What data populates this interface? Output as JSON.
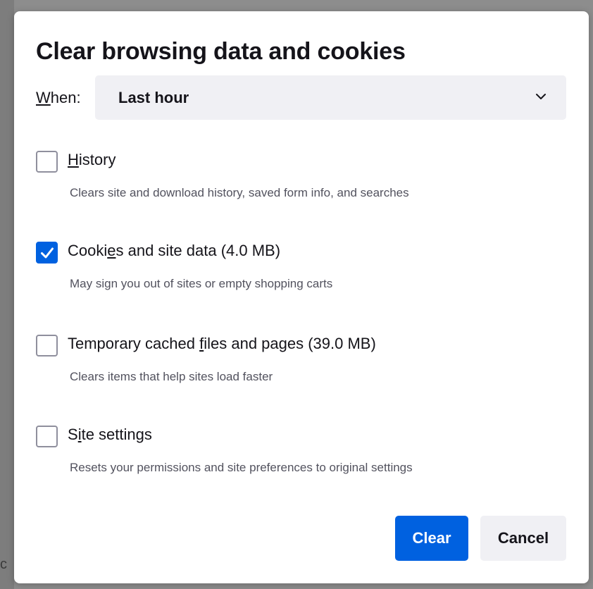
{
  "dialog": {
    "title": "Clear browsing data and cookies",
    "when": {
      "label_prefix": "",
      "label_access": "W",
      "label_rest": "hen:",
      "selected": "Last hour"
    },
    "options": [
      {
        "label_before": "",
        "label_access": "H",
        "label_after": "istory",
        "description": "Clears site and download history, saved form info, and searches",
        "checked": false
      },
      {
        "label_before": "Cooki",
        "label_access": "e",
        "label_after": "s and site data (4.0 MB)",
        "description": "May sign you out of sites or empty shopping carts",
        "checked": true
      },
      {
        "label_before": "Temporary cached ",
        "label_access": "f",
        "label_after": "iles and pages (39.0 MB)",
        "description": "Clears items that help sites load faster",
        "checked": false
      },
      {
        "label_before": "S",
        "label_access": "i",
        "label_after": "te settings",
        "description": "Resets your permissions and site preferences to original settings",
        "checked": false
      }
    ],
    "buttons": {
      "clear": "Clear",
      "cancel": "Cancel"
    }
  },
  "backdrop": {
    "partial_text": "c"
  },
  "colors": {
    "accent": "#0061e0",
    "text": "#15141a",
    "secondary_text": "#52525e",
    "control_bg": "#f0f0f4"
  },
  "icons": {
    "dropdown": "chevron-down-icon",
    "checked": "checkmark-icon"
  }
}
